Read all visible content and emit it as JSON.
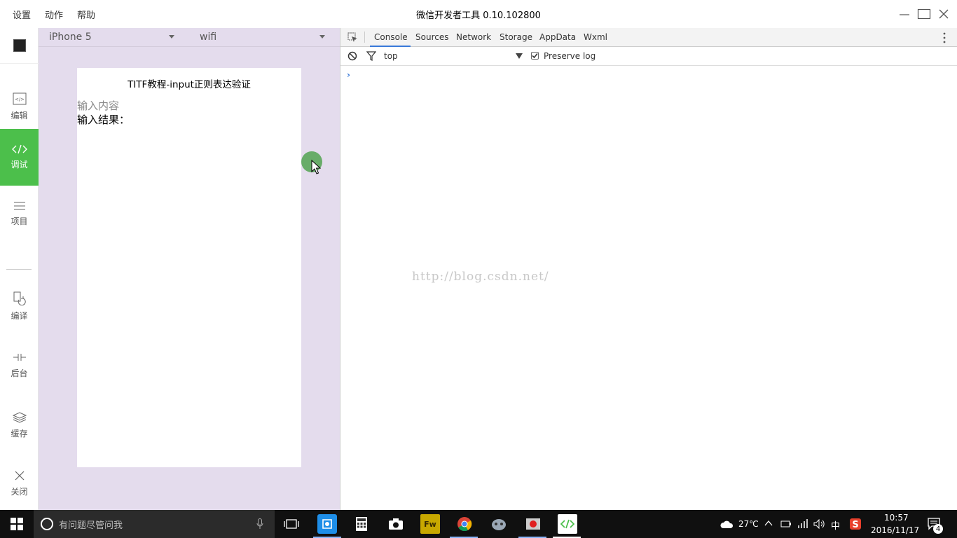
{
  "titlebar": {
    "menu": [
      "设置",
      "动作",
      "帮助"
    ],
    "title": "微信开发者工具 0.10.102800"
  },
  "sidebar": {
    "items": [
      {
        "label": "编辑",
        "icon": "code-file-icon"
      },
      {
        "label": "调试",
        "icon": "code-brackets-icon",
        "active": true
      },
      {
        "label": "项目",
        "icon": "menu-lines-icon"
      },
      {
        "label": "编译",
        "icon": "compile-icon"
      },
      {
        "label": "后台",
        "icon": "backend-icon"
      },
      {
        "label": "缓存",
        "icon": "layers-icon"
      },
      {
        "label": "关闭",
        "icon": "close-icon"
      }
    ]
  },
  "simulator": {
    "device": "iPhone 5",
    "network": "wifi",
    "page_title": "TITF教程-input正则表达验证",
    "input_placeholder": "输入内容",
    "result_label": "输入结果："
  },
  "devtools": {
    "tabs": [
      "Console",
      "Sources",
      "Network",
      "Storage",
      "AppData",
      "Wxml"
    ],
    "active_tab": "Console",
    "context": "top",
    "preserve_log_label": "Preserve log",
    "preserve_log_checked": true,
    "prompt": "›",
    "watermark": "http://blog.csdn.net/"
  },
  "taskbar": {
    "search_placeholder": "有问题尽管问我",
    "weather": "27℃",
    "ime": "中",
    "time": "10:57",
    "date": "2016/11/17",
    "notifications": "4"
  },
  "colors": {
    "accent_green": "#4cbf4b",
    "simulator_bg": "#e4dced",
    "devtools_tab_accent": "#3879d9"
  }
}
